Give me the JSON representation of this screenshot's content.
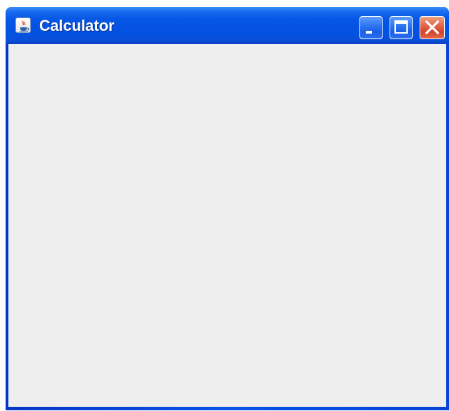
{
  "window": {
    "title": "Calculator",
    "app_icon": "java-coffee-cup-icon",
    "controls": {
      "minimize": "minimize-icon",
      "maximize": "maximize-icon",
      "close": "close-icon"
    }
  },
  "colors": {
    "titlebar": "#0452e0",
    "client_background": "#eeeeee",
    "close_button": "#d4442a"
  }
}
